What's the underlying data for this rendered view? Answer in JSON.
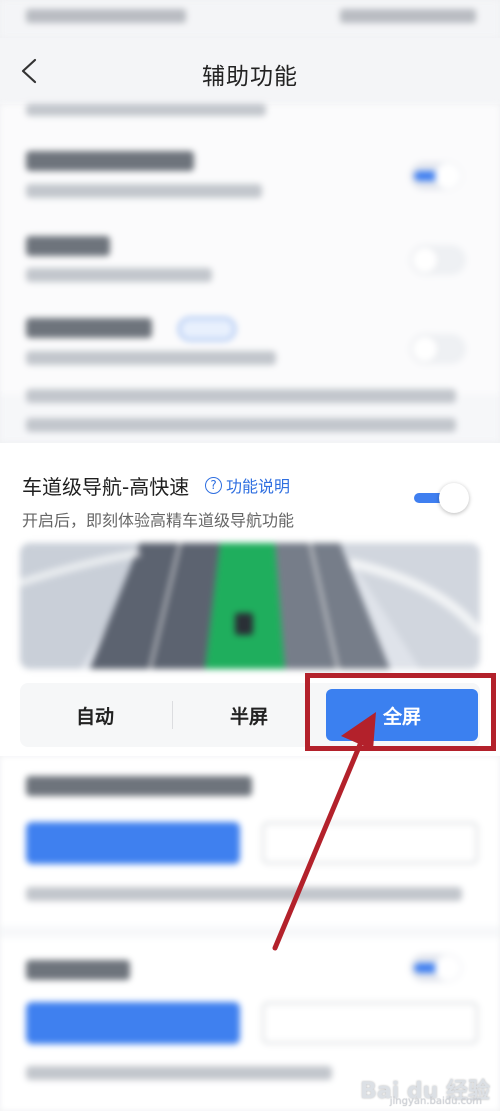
{
  "header": {
    "title": "辅助功能"
  },
  "feature": {
    "title": "车道级导航-高快速",
    "help_label": "功能说明",
    "help_icon_glyph": "?",
    "description": "开启后，即刻体验高精车道级导航功能",
    "toggle_on": true
  },
  "display_modes": {
    "options": [
      "自动",
      "半屏",
      "全屏"
    ],
    "selected": "全屏"
  },
  "colors": {
    "accent": "#3b80f0",
    "link": "#2f6fe0",
    "annotation_red": "#b3212b"
  },
  "watermark": {
    "logo": "Bai du 经验",
    "sub": "jingyan.baidu.com"
  }
}
